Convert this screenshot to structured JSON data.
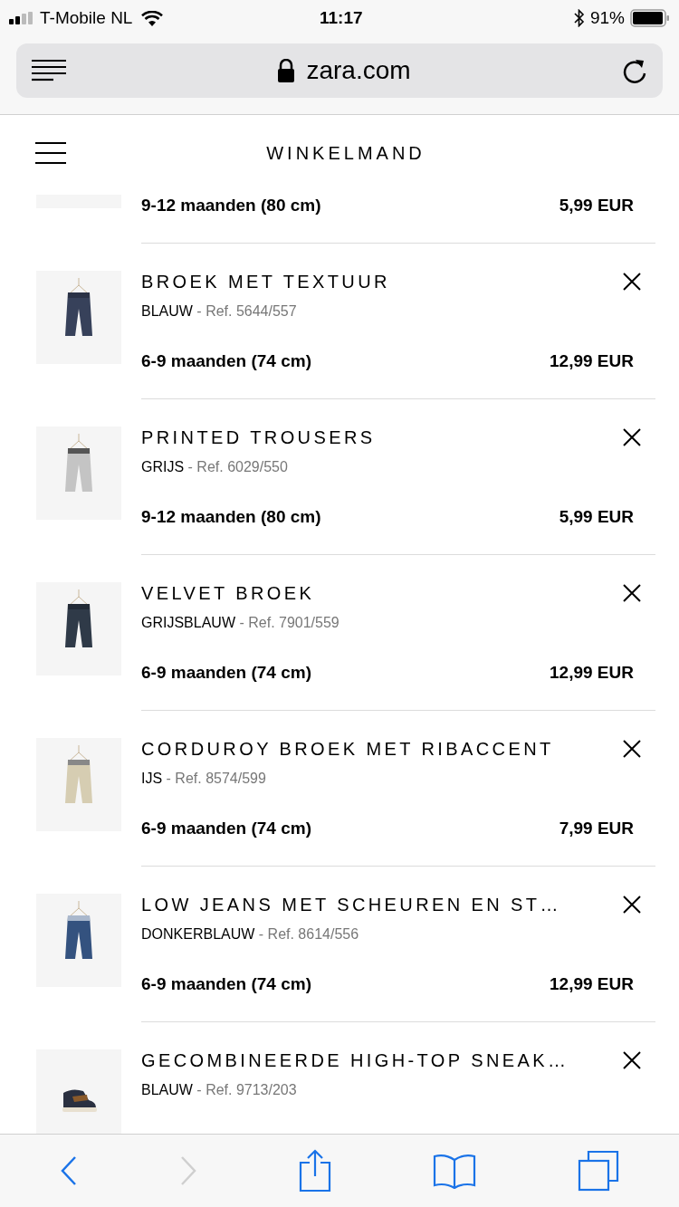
{
  "status_bar": {
    "carrier": "T-Mobile NL",
    "time": "11:17",
    "battery": "91%"
  },
  "address_bar": {
    "url": "zara.com"
  },
  "header": {
    "title": "WINKELMAND"
  },
  "cart_items": [
    {
      "size": "9-12 maanden (80 cm)",
      "price": "5,99 EUR"
    },
    {
      "name": "BROEK MET TEXTUUR",
      "variant": "BLAUW",
      "ref": "- Ref. 5644/557",
      "size": "6-9 maanden (74 cm)",
      "price": "12,99 EUR"
    },
    {
      "name": "PRINTED TROUSERS",
      "variant": "GRIJS",
      "ref": "- Ref. 6029/550",
      "size": "9-12 maanden (80 cm)",
      "price": "5,99 EUR"
    },
    {
      "name": "VELVET BROEK",
      "variant": "GRIJSBLAUW",
      "ref": "- Ref. 7901/559",
      "size": "6-9 maanden (74 cm)",
      "price": "12,99 EUR"
    },
    {
      "name": "CORDUROY BROEK MET RIBACCENT",
      "variant": "IJS",
      "ref": "- Ref. 8574/599",
      "size": "6-9 maanden (74 cm)",
      "price": "7,99 EUR"
    },
    {
      "name": "LOW JEANS MET SCHEUREN EN ST…",
      "variant": "DONKERBLAUW",
      "ref": "- Ref. 8614/556",
      "size": "6-9 maanden (74 cm)",
      "price": "12,99 EUR"
    },
    {
      "name": "GECOMBINEERDE HIGH-TOP SNEAK…",
      "variant": "BLAUW",
      "ref": "- Ref. 9713/203"
    }
  ],
  "toolbar": {
    "back": {
      "disabled": false
    },
    "forward": {
      "disabled": true
    }
  }
}
